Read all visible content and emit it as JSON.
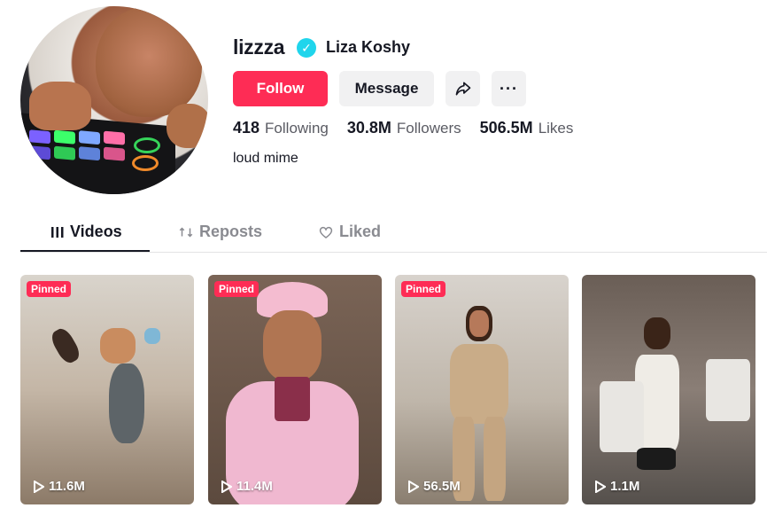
{
  "profile": {
    "username": "lizzza",
    "nickname": "Liza Koshy",
    "verified_mark": "✓",
    "bio": "loud mime"
  },
  "actions": {
    "follow_label": "Follow",
    "message_label": "Message",
    "share_icon": "share-icon",
    "more_label": "···"
  },
  "stats": {
    "following": {
      "value": "418",
      "label": "Following"
    },
    "followers": {
      "value": "30.8M",
      "label": "Followers"
    },
    "likes": {
      "value": "506.5M",
      "label": "Likes"
    }
  },
  "tabs": [
    {
      "label": "Videos",
      "icon": "grid-icon",
      "active": true
    },
    {
      "label": "Reposts",
      "icon": "repost-icon",
      "active": false
    },
    {
      "label": "Liked",
      "icon": "heart-icon",
      "active": false
    }
  ],
  "videos": [
    {
      "badge": "Pinned",
      "views": "11.6M"
    },
    {
      "badge": "Pinned",
      "views": "11.4M"
    },
    {
      "badge": "Pinned",
      "views": "56.5M"
    },
    {
      "badge": "",
      "views": "1.1M"
    }
  ],
  "colors": {
    "accent": "#fe2c55",
    "verified": "#20d5ec",
    "button_gray": "#f1f1f2",
    "text": "#161823",
    "muted": "#5a5b63"
  }
}
